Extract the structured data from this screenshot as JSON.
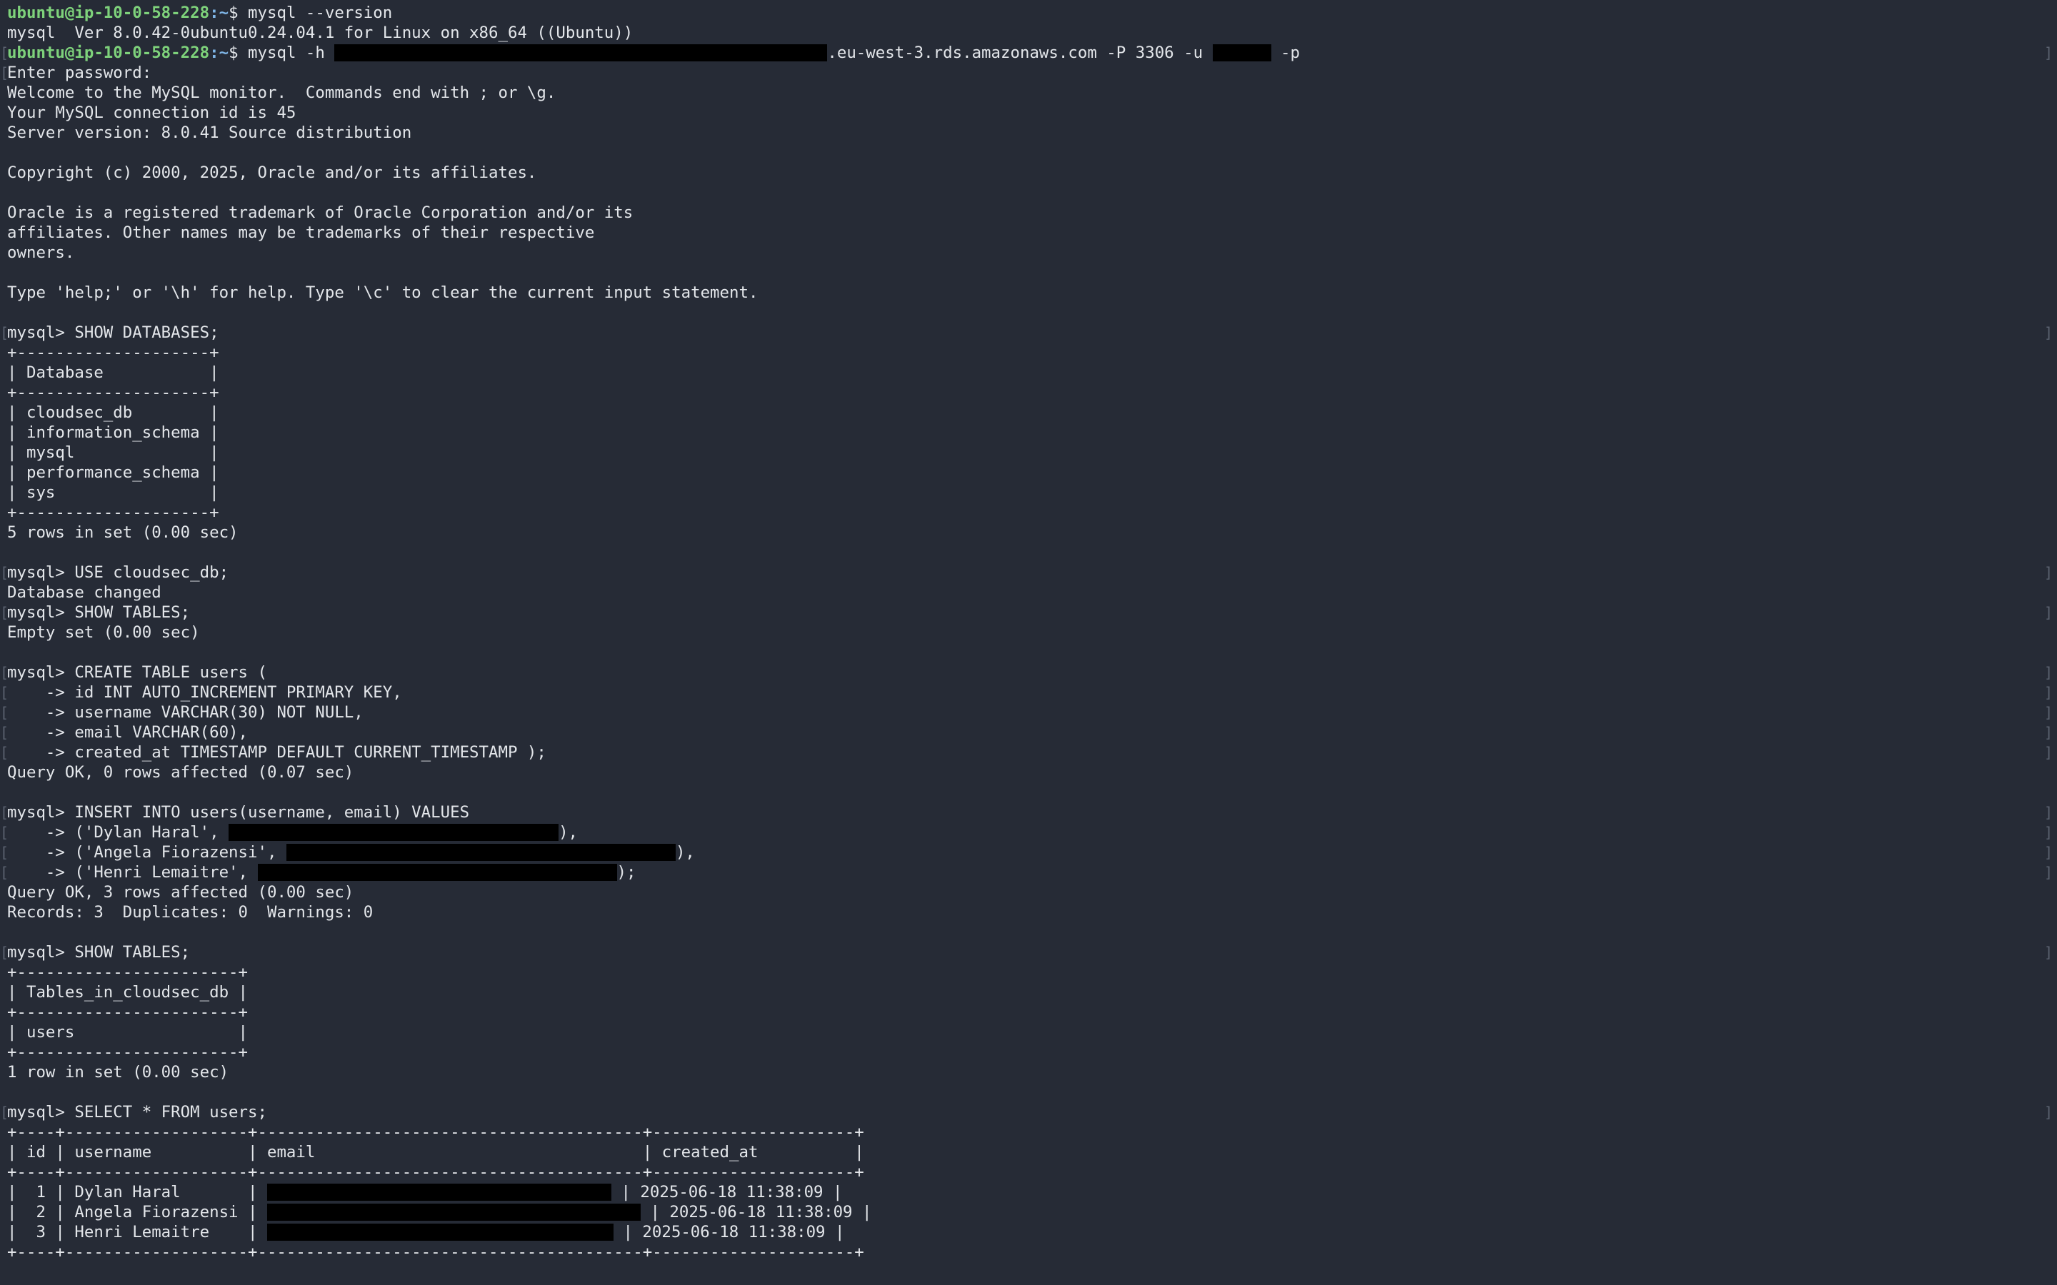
{
  "terminal": {
    "prompt_user_host": "ubuntu@ip-10-0-58-228",
    "prompt_path": ":~",
    "prompt_symbol": "$ ",
    "lines": [
      {
        "kind": "shell",
        "cmd": "mysql --version"
      },
      {
        "kind": "text",
        "text": "mysql  Ver 8.0.42-0ubuntu0.24.04.1 for Linux on x86_64 ((Ubuntu))"
      },
      {
        "kind": "shell_conn",
        "cmd_prefix": "mysql -h ",
        "cmd_host_suffix": ".eu-west-3.rds.amazonaws.com -P 3306 -u ",
        "cmd_tail": " -p"
      },
      {
        "kind": "text",
        "text": "Enter password:"
      },
      {
        "kind": "text",
        "text": "Welcome to the MySQL monitor.  Commands end with ; or \\g."
      },
      {
        "kind": "text",
        "text": "Your MySQL connection id is 45"
      },
      {
        "kind": "text",
        "text": "Server version: 8.0.41 Source distribution"
      },
      {
        "kind": "text",
        "text": ""
      },
      {
        "kind": "text",
        "text": "Copyright (c) 2000, 2025, Oracle and/or its affiliates."
      },
      {
        "kind": "text",
        "text": ""
      },
      {
        "kind": "text",
        "text": "Oracle is a registered trademark of Oracle Corporation and/or its"
      },
      {
        "kind": "text",
        "text": "affiliates. Other names may be trademarks of their respective"
      },
      {
        "kind": "text",
        "text": "owners."
      },
      {
        "kind": "text",
        "text": ""
      },
      {
        "kind": "text",
        "text": "Type 'help;' or '\\h' for help. Type '\\c' to clear the current input statement."
      },
      {
        "kind": "text",
        "text": ""
      },
      {
        "kind": "text",
        "text": "mysql> SHOW DATABASES;"
      },
      {
        "kind": "text",
        "text": "+--------------------+"
      },
      {
        "kind": "text",
        "text": "| Database           |"
      },
      {
        "kind": "text",
        "text": "+--------------------+"
      },
      {
        "kind": "text",
        "text": "| cloudsec_db        |"
      },
      {
        "kind": "text",
        "text": "| information_schema |"
      },
      {
        "kind": "text",
        "text": "| mysql              |"
      },
      {
        "kind": "text",
        "text": "| performance_schema |"
      },
      {
        "kind": "text",
        "text": "| sys                |"
      },
      {
        "kind": "text",
        "text": "+--------------------+"
      },
      {
        "kind": "text",
        "text": "5 rows in set (0.00 sec)"
      },
      {
        "kind": "text",
        "text": ""
      },
      {
        "kind": "text",
        "text": "mysql> USE cloudsec_db;"
      },
      {
        "kind": "text",
        "text": "Database changed"
      },
      {
        "kind": "text",
        "text": "mysql> SHOW TABLES;"
      },
      {
        "kind": "text",
        "text": "Empty set (0.00 sec)"
      },
      {
        "kind": "text",
        "text": ""
      },
      {
        "kind": "text",
        "text": "mysql> CREATE TABLE users ("
      },
      {
        "kind": "text",
        "text": "    -> id INT AUTO_INCREMENT PRIMARY KEY,"
      },
      {
        "kind": "text",
        "text": "    -> username VARCHAR(30) NOT NULL,"
      },
      {
        "kind": "text",
        "text": "    -> email VARCHAR(60),"
      },
      {
        "kind": "text",
        "text": "    -> created_at TIMESTAMP DEFAULT CURRENT_TIMESTAMP );"
      },
      {
        "kind": "text",
        "text": "Query OK, 0 rows affected (0.07 sec)"
      },
      {
        "kind": "text",
        "text": ""
      },
      {
        "kind": "text",
        "text": "mysql> INSERT INTO users(username, email) VALUES"
      },
      {
        "kind": "redacted",
        "before": "    -> ('Dylan Haral', ",
        "after": "),"
      },
      {
        "kind": "redacted",
        "before": "    -> ('Angela Fiorazensi', ",
        "after": "),"
      },
      {
        "kind": "redacted",
        "before": "    -> ('Henri Lemaitre', ",
        "after": ");"
      },
      {
        "kind": "text",
        "text": "Query OK, 3 rows affected (0.00 sec)"
      },
      {
        "kind": "text",
        "text": "Records: 3  Duplicates: 0  Warnings: 0"
      },
      {
        "kind": "text",
        "text": ""
      },
      {
        "kind": "text",
        "text": "mysql> SHOW TABLES;"
      },
      {
        "kind": "text",
        "text": "+-----------------------+"
      },
      {
        "kind": "text",
        "text": "| Tables_in_cloudsec_db |"
      },
      {
        "kind": "text",
        "text": "+-----------------------+"
      },
      {
        "kind": "text",
        "text": "| users                 |"
      },
      {
        "kind": "text",
        "text": "+-----------------------+"
      },
      {
        "kind": "text",
        "text": "1 row in set (0.00 sec)"
      },
      {
        "kind": "text",
        "text": ""
      },
      {
        "kind": "text",
        "text": "mysql> SELECT * FROM users;"
      },
      {
        "kind": "text",
        "text": "+----+-------------------+----------------------------------------+---------------------+"
      },
      {
        "kind": "text",
        "text": "| id | username          | email                                  | created_at          |"
      },
      {
        "kind": "text",
        "text": "+----+-------------------+----------------------------------------+---------------------+"
      },
      {
        "kind": "redacted",
        "before": "|  1 | Dylan Haral       | ",
        "after": " | 2025-06-18 11:38:09 |"
      },
      {
        "kind": "redacted",
        "before": "|  2 | Angela Fiorazensi | ",
        "after": " | 2025-06-18 11:38:09 |"
      },
      {
        "kind": "redacted",
        "before": "|  3 | Henri Lemaitre    | ",
        "after": " | 2025-06-18 11:38:09 |"
      },
      {
        "kind": "text",
        "text": "+----+-------------------+----------------------------------------+---------------------+"
      }
    ],
    "bracket_left": "[",
    "bracket_right": "]"
  },
  "colors": {
    "background": "#262b36",
    "foreground": "#e3e6ea",
    "prompt_user": "#7ed27b",
    "prompt_path": "#7fb5e6",
    "redaction": "#000000"
  }
}
